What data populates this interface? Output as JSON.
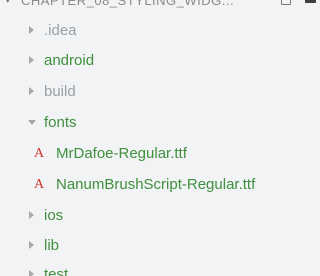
{
  "explorer": {
    "header": {
      "title": "CHAPTER_08_STYLING_WIDG..."
    },
    "colors": {
      "ignored": "#9aa0a6",
      "untracked": "#3f8f3f",
      "font_icon": "#d0352f",
      "arrow": "#a8a8a8"
    },
    "items": [
      {
        "label": ".idea",
        "type": "folder",
        "expanded": false,
        "status": "ignored"
      },
      {
        "label": "android",
        "type": "folder",
        "expanded": false,
        "status": "untracked"
      },
      {
        "label": "build",
        "type": "folder",
        "expanded": false,
        "status": "ignored"
      },
      {
        "label": "fonts",
        "type": "folder",
        "expanded": true,
        "status": "untracked"
      },
      {
        "label": "MrDafoe-Regular.ttf",
        "type": "file",
        "icon": "font-file-icon",
        "icon_glyph": "A",
        "status": "untracked"
      },
      {
        "label": "NanumBrushScript-Regular.ttf",
        "type": "file",
        "icon": "font-file-icon",
        "icon_glyph": "A",
        "status": "untracked"
      },
      {
        "label": "ios",
        "type": "folder",
        "expanded": false,
        "status": "untracked"
      },
      {
        "label": "lib",
        "type": "folder",
        "expanded": false,
        "status": "untracked"
      },
      {
        "label": "test",
        "type": "folder",
        "expanded": false,
        "status": "untracked"
      }
    ]
  }
}
